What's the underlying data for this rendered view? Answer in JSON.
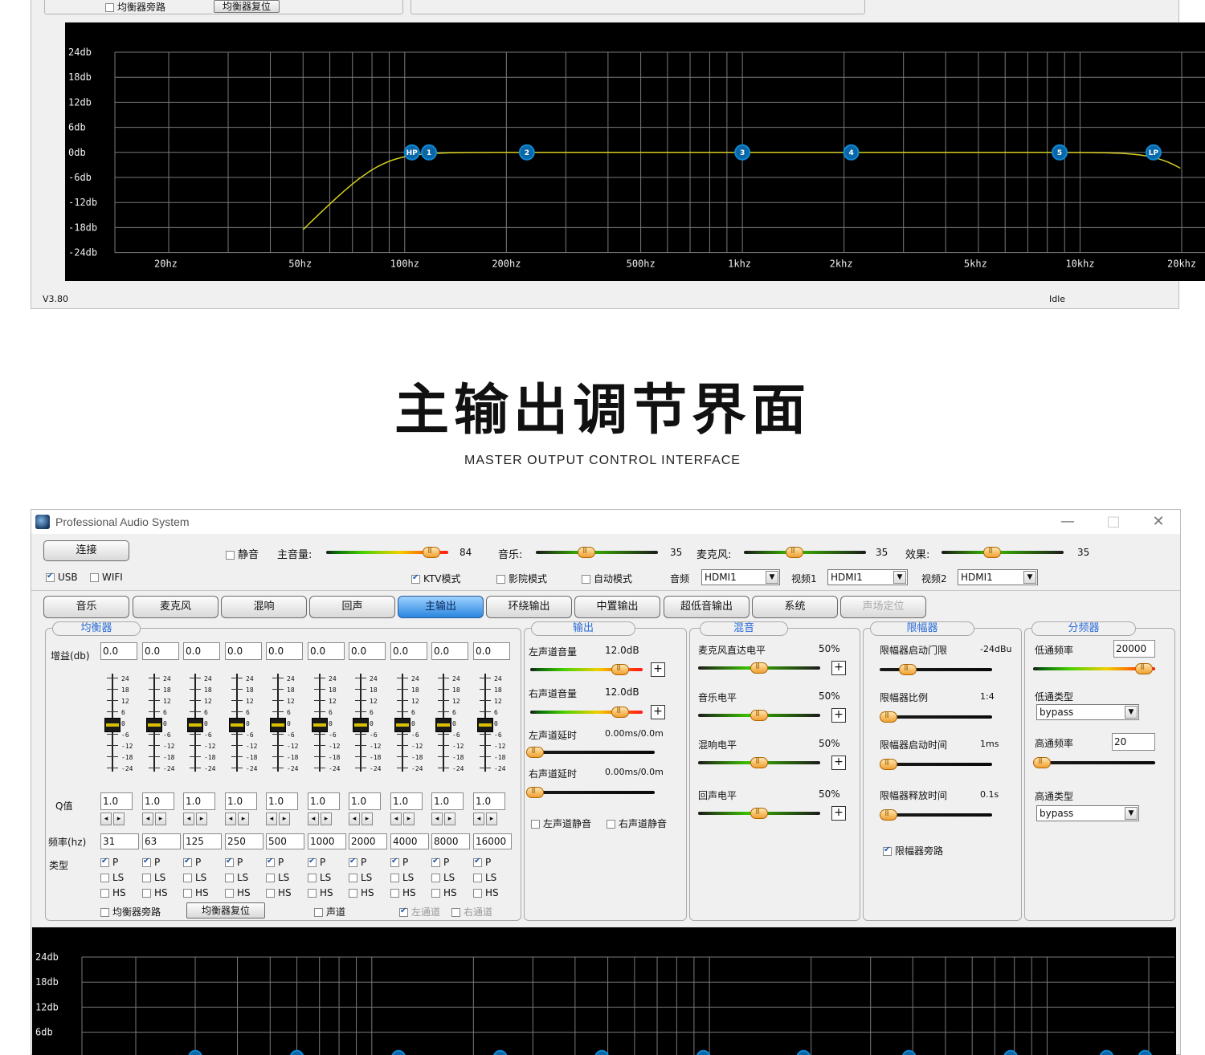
{
  "top_window": {
    "eq_bypass_label": "均衡器旁路",
    "eq_reset_label": "均衡器复位",
    "graph": {
      "y_labels": [
        "24db",
        "18db",
        "12db",
        "6db",
        "0db",
        "-6db",
        "-12db",
        "-18db",
        "-24db"
      ],
      "x_labels": [
        "20hz",
        "50hz",
        "100hz",
        "200hz",
        "500hz",
        "1khz",
        "2khz",
        "5khz",
        "10khz",
        "20khz"
      ],
      "nodes": [
        "HP",
        "1",
        "2",
        "3",
        "4",
        "5",
        "LP"
      ],
      "curve_color": "#d6cf1e"
    },
    "version": "V3.80",
    "status": "Idle"
  },
  "heading": {
    "title": "主输出调节界面",
    "subtitle": "MASTER OUTPUT CONTROL INTERFACE"
  },
  "main_window": {
    "title": "Professional Audio System",
    "controls": {
      "minimize": "—",
      "maximize": "□",
      "close": "✕"
    },
    "connect_button": "连接",
    "usb_label": "USB",
    "wifi_label": "WIFI",
    "mute_label": "静音",
    "master_volume_label": "主音量:",
    "master_volume_value": "84",
    "master_volume_level": 0.92,
    "music_label": "音乐:",
    "music_value": "35",
    "music_level": 0.4,
    "mic_label": "麦克风:",
    "mic_value": "35",
    "mic_level": 0.4,
    "effect_label": "效果:",
    "effect_value": "35",
    "effect_level": 0.4,
    "modes": [
      {
        "label": "KTV模式",
        "checked": true
      },
      {
        "label": "影院模式",
        "checked": false
      },
      {
        "label": "自动模式",
        "checked": false
      }
    ],
    "audio_label": "音频",
    "audio_value": "HDMI1",
    "video1_label": "视频1",
    "video1_value": "HDMI1",
    "video2_label": "视频2",
    "video2_value": "HDMI1",
    "tabs": [
      {
        "label": "音乐",
        "state": "normal"
      },
      {
        "label": "麦克风",
        "state": "normal"
      },
      {
        "label": "混响",
        "state": "normal"
      },
      {
        "label": "回声",
        "state": "normal"
      },
      {
        "label": "主输出",
        "state": "active"
      },
      {
        "label": "环绕输出",
        "state": "normal"
      },
      {
        "label": "中置输出",
        "state": "normal"
      },
      {
        "label": "超低音输出",
        "state": "normal"
      },
      {
        "label": "系统",
        "state": "normal"
      },
      {
        "label": "声场定位",
        "state": "disabled"
      }
    ],
    "equalizer": {
      "group_label": "均衡器",
      "gain_label": "增益(db)",
      "q_label": "Q值",
      "freq_label": "频率(hz)",
      "type_label": "类型",
      "scale": [
        "24",
        "18",
        "12",
        "6",
        "0",
        "-6",
        "-12",
        "-18",
        "-24"
      ],
      "bands": [
        {
          "gain": "0.0",
          "q": "1.0",
          "freq": "31"
        },
        {
          "gain": "0.0",
          "q": "1.0",
          "freq": "63"
        },
        {
          "gain": "0.0",
          "q": "1.0",
          "freq": "125"
        },
        {
          "gain": "0.0",
          "q": "1.0",
          "freq": "250"
        },
        {
          "gain": "0.0",
          "q": "1.0",
          "freq": "500"
        },
        {
          "gain": "0.0",
          "q": "1.0",
          "freq": "1000"
        },
        {
          "gain": "0.0",
          "q": "1.0",
          "freq": "2000"
        },
        {
          "gain": "0.0",
          "q": "1.0",
          "freq": "4000"
        },
        {
          "gain": "0.0",
          "q": "1.0",
          "freq": "8000"
        },
        {
          "gain": "0.0",
          "q": "1.0",
          "freq": "16000"
        }
      ],
      "type_p": "P",
      "type_ls": "LS",
      "type_hs": "HS",
      "eq_bypass_label": "均衡器旁路",
      "eq_reset_label": "均衡器复位",
      "voice_label": "声道",
      "left_channel_label": "左通道",
      "right_channel_label": "右通道"
    },
    "output": {
      "group_label": "输出",
      "left_vol_label": "左声道音量",
      "left_vol_value": "12.0dB",
      "right_vol_label": "右声道音量",
      "right_vol_value": "12.0dB",
      "left_delay_label": "左声道延时",
      "left_delay_value": "0.00ms/0.0m",
      "right_delay_label": "右声道延时",
      "right_delay_value": "0.00ms/0.0m",
      "left_mute_label": "左声道静音",
      "right_mute_label": "右声道静音"
    },
    "mix": {
      "group_label": "混音",
      "items": [
        {
          "label": "麦克风直达电平",
          "value": "50%"
        },
        {
          "label": "音乐电平",
          "value": "50%"
        },
        {
          "label": "混响电平",
          "value": "50%"
        },
        {
          "label": "回声电平",
          "value": "50%"
        }
      ]
    },
    "limiter": {
      "group_label": "限幅器",
      "items": [
        {
          "label": "限幅器启动门限",
          "value": "-24dBu"
        },
        {
          "label": "限幅器比例",
          "value": "1:4"
        },
        {
          "label": "限幅器启动时间",
          "value": "1ms"
        },
        {
          "label": "限幅器释放时间",
          "value": "0.1s"
        }
      ],
      "bypass_label": "限幅器旁路"
    },
    "crossover": {
      "group_label": "分频器",
      "lowpass_freq_label": "低通频率",
      "lowpass_freq_value": "20000",
      "lowpass_type_label": "低通类型",
      "lowpass_type_value": "bypass",
      "highpass_freq_label": "高通频率",
      "highpass_freq_value": "20",
      "highpass_type_label": "高通类型",
      "highpass_type_value": "bypass"
    },
    "graph": {
      "y_labels": [
        "24db",
        "18db",
        "12db",
        "6db"
      ]
    }
  }
}
